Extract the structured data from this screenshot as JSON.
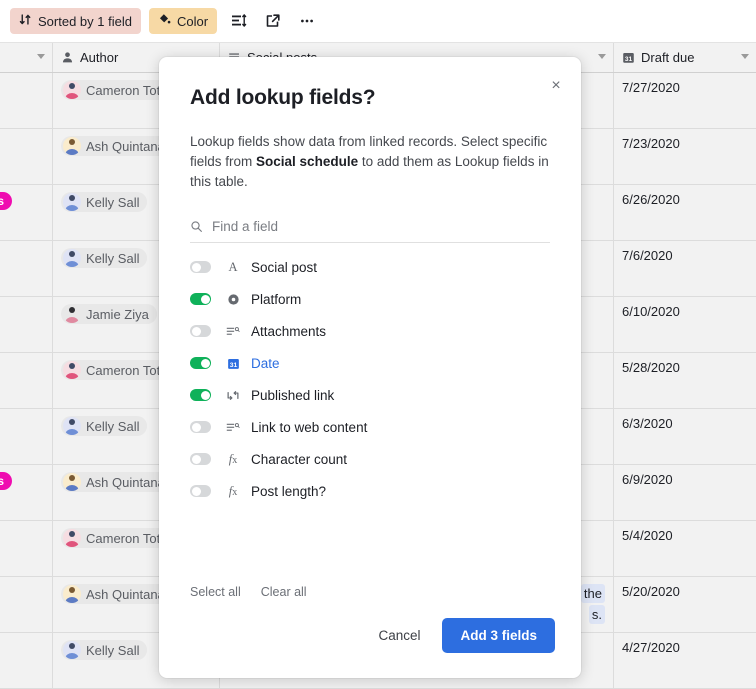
{
  "toolbar": {
    "sorted_label": "Sorted by 1 field",
    "color_label": "Color",
    "row_height_icon": "row-height-icon",
    "share_icon": "share-icon",
    "more_icon": "more-options-icon"
  },
  "grid": {
    "columns": [
      {
        "label": "",
        "icon": ""
      },
      {
        "label": "Author",
        "icon": "person-icon"
      },
      {
        "label": "Social posts",
        "icon": "long-text-icon"
      },
      {
        "label": "Draft due",
        "icon": "calendar-icon"
      }
    ],
    "rows": [
      {
        "tag": "",
        "author": "Cameron Tot",
        "notes": "",
        "due": "7/27/2020"
      },
      {
        "tag": "",
        "author": "Ash Quintana",
        "notes": "",
        "due": "7/23/2020"
      },
      {
        "tag": "ls",
        "author": "Kelly Sall",
        "notes": "",
        "due": "6/26/2020"
      },
      {
        "tag": "",
        "author": "Kelly Sall",
        "notes": "",
        "due": "7/6/2020"
      },
      {
        "tag": "",
        "author": "Jamie Ziya",
        "notes": "",
        "due": "6/10/2020"
      },
      {
        "tag": "",
        "author": "Cameron Tot",
        "notes": "",
        "due": "5/28/2020"
      },
      {
        "tag": "",
        "author": "Kelly Sall",
        "notes": "",
        "due": "6/3/2020"
      },
      {
        "tag": "ls",
        "author": "Ash Quintana",
        "notes": "",
        "due": "6/9/2020"
      },
      {
        "tag": "",
        "author": "Cameron Tot",
        "notes": "",
        "due": "5/4/2020"
      },
      {
        "tag": "",
        "author": "Ash Quintana",
        "notes": "the",
        "notes2": "s.",
        "due": "5/20/2020"
      },
      {
        "tag": "",
        "author": "Kelly Sall",
        "notes": "",
        "due": "4/27/2020"
      }
    ]
  },
  "modal": {
    "title": "Add lookup fields?",
    "description_pre": "Lookup fields show data from linked records. Select specific fields from ",
    "description_bold": "Social schedule",
    "description_post": " to add them as Lookup fields in this table.",
    "close_label": "×",
    "search": {
      "placeholder": "Find a field",
      "value": "",
      "icon": "search-icon"
    },
    "fields": [
      {
        "name": "Social post",
        "type_icon": "text-icon",
        "type_glyph": "A",
        "on": false,
        "blue": false
      },
      {
        "name": "Platform",
        "type_icon": "single-select-icon",
        "type_glyph": "",
        "on": true,
        "blue": false
      },
      {
        "name": "Attachments",
        "type_icon": "long-text-icon",
        "type_glyph": "",
        "on": false,
        "blue": false
      },
      {
        "name": "Date",
        "type_icon": "calendar-icon",
        "type_glyph": "31",
        "on": true,
        "blue": true
      },
      {
        "name": "Published link",
        "type_icon": "link-icon",
        "type_glyph": "",
        "on": true,
        "blue": false
      },
      {
        "name": "Link to web content",
        "type_icon": "long-text-icon",
        "type_glyph": "",
        "on": false,
        "blue": false
      },
      {
        "name": "Character count",
        "type_icon": "formula-icon",
        "type_glyph": "fx",
        "on": false,
        "blue": false
      },
      {
        "name": "Post length?",
        "type_icon": "formula-icon",
        "type_glyph": "fx",
        "on": false,
        "blue": false
      }
    ],
    "select_all_label": "Select all",
    "clear_all_label": "Clear all",
    "cancel_label": "Cancel",
    "submit_label": "Add 3 fields"
  },
  "colors": {
    "sorted_bg": "#f2d4cd",
    "color_bg": "#f7d9a5",
    "toggle_on": "#0fb15a",
    "toggle_off": "#d6d8da",
    "primary": "#2d6ee0",
    "tag": "#ef0cb0",
    "date_icon": "#2d6ee0"
  }
}
